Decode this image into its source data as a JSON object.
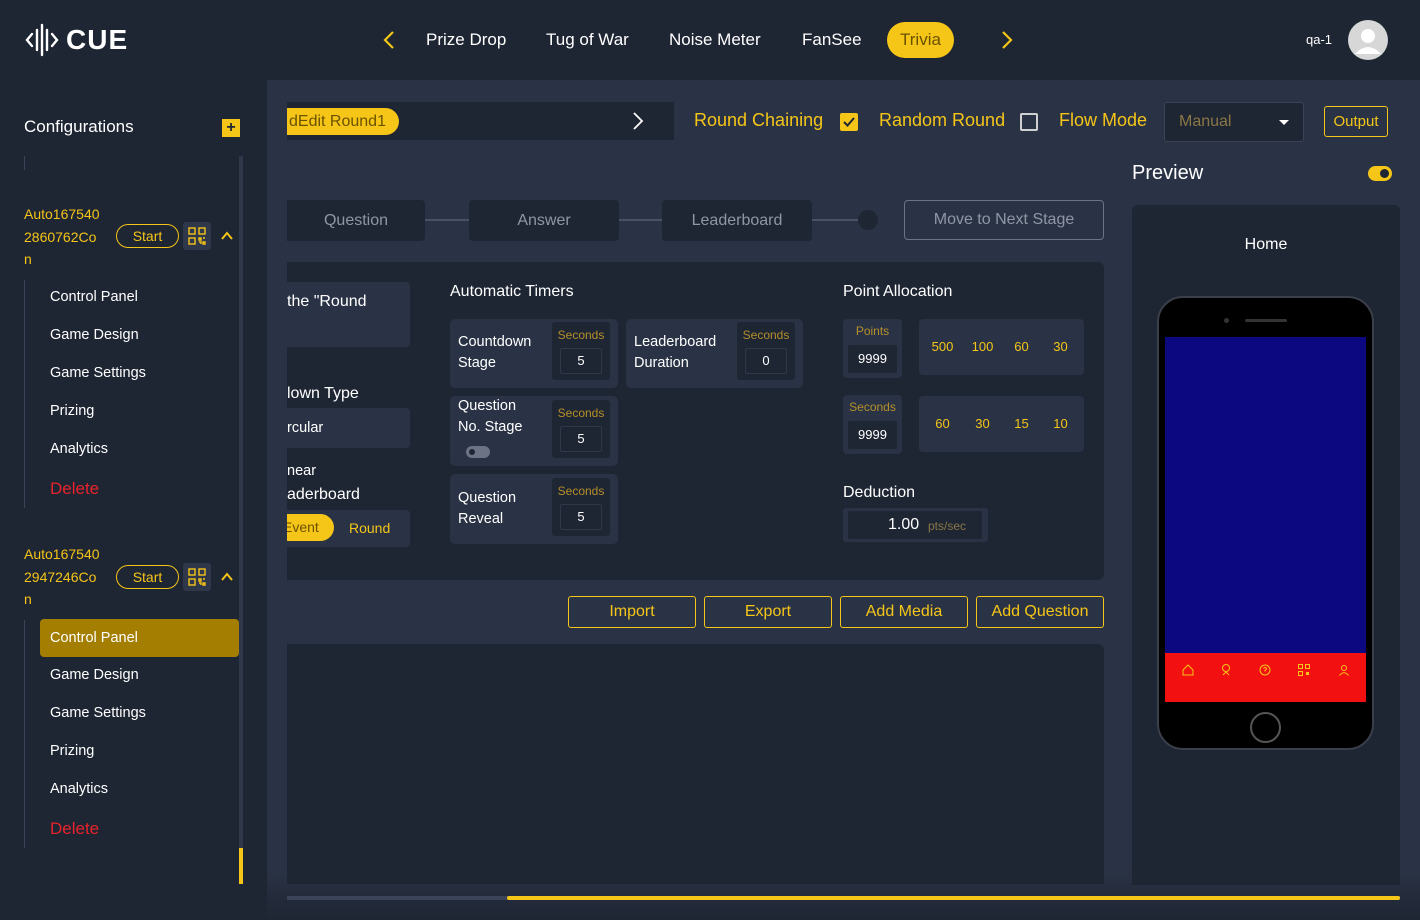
{
  "app": {
    "logo_text": "CUE"
  },
  "nav": {
    "tabs": [
      {
        "label": "Prize Drop"
      },
      {
        "label": "Tug of War"
      },
      {
        "label": "Noise Meter"
      },
      {
        "label": "FanSee"
      },
      {
        "label": "Trivia"
      }
    ],
    "active_tab": "Trivia",
    "user": "qa-1"
  },
  "sidebar": {
    "title": "Configurations",
    "configs": [
      {
        "name": "Auto1675402860762Con",
        "name_lines": [
          "Auto167540",
          "2860762Co",
          "n"
        ],
        "start_label": "Start",
        "items": [
          "Control Panel",
          "Game Design",
          "Game Settings",
          "Prizing",
          "Analytics"
        ],
        "delete_label": "Delete"
      },
      {
        "name": "Auto1675402947246Con",
        "name_lines": [
          "Auto167540",
          "2947246Co",
          "n"
        ],
        "start_label": "Start",
        "items": [
          "Control Panel",
          "Game Design",
          "Game Settings",
          "Prizing",
          "Analytics"
        ],
        "delete_label": "Delete",
        "active_item": "Control Panel"
      }
    ]
  },
  "toolbar": {
    "round_label": "dEdit Round1",
    "round_chaining_label": "Round Chaining",
    "round_chaining_checked": true,
    "random_round_label": "Random Round",
    "random_round_checked": false,
    "flow_mode_label": "Flow Mode",
    "flow_mode_value": "Manual",
    "output_label": "Output"
  },
  "stages": {
    "items": [
      "Question",
      "Answer",
      "Leaderboard"
    ],
    "next_label": "Move to Next Stage"
  },
  "settings": {
    "left": {
      "round_text": "the \"Round",
      "countdown_type_label": "lown Type",
      "countdown_type_value": "rcular",
      "linear_text": "near",
      "leaderboard_text": "aderboard",
      "seg_event": "Event",
      "seg_round": "Round"
    },
    "timers": {
      "title": "Automatic Timers",
      "cards": [
        {
          "line1": "Countdown",
          "line2": "Stage",
          "unit": "Seconds",
          "value": "5"
        },
        {
          "line1": "Leaderboard",
          "line2": "Duration",
          "unit": "Seconds",
          "value": "0"
        },
        {
          "line1": "Question",
          "line2": "No. Stage",
          "unit": "Seconds",
          "value": "5",
          "toggle": false
        },
        {
          "line1": "Question",
          "line2": "Reveal",
          "unit": "Seconds",
          "value": "5"
        }
      ]
    },
    "points": {
      "title": "Point Allocation",
      "points_unit": "Points",
      "points_value": "9999",
      "points_tiers": [
        "500",
        "100",
        "60",
        "30"
      ],
      "seconds_unit": "Seconds",
      "seconds_value": "9999",
      "seconds_tiers": [
        "60",
        "30",
        "15",
        "10"
      ]
    },
    "deduction": {
      "title": "Deduction",
      "value": "1.00",
      "unit": "pts/sec"
    }
  },
  "actions": [
    "Import",
    "Export",
    "Add Media",
    "Add Question"
  ],
  "preview": {
    "title": "Preview",
    "enabled": true,
    "screen_title": "Home",
    "screen_color": "#0c0880",
    "tabbar_color": "#f21010"
  },
  "colors": {
    "accent": "#f5c518",
    "bg": "#2a3345",
    "panel": "#1e2533",
    "danger": "#e8232b"
  }
}
